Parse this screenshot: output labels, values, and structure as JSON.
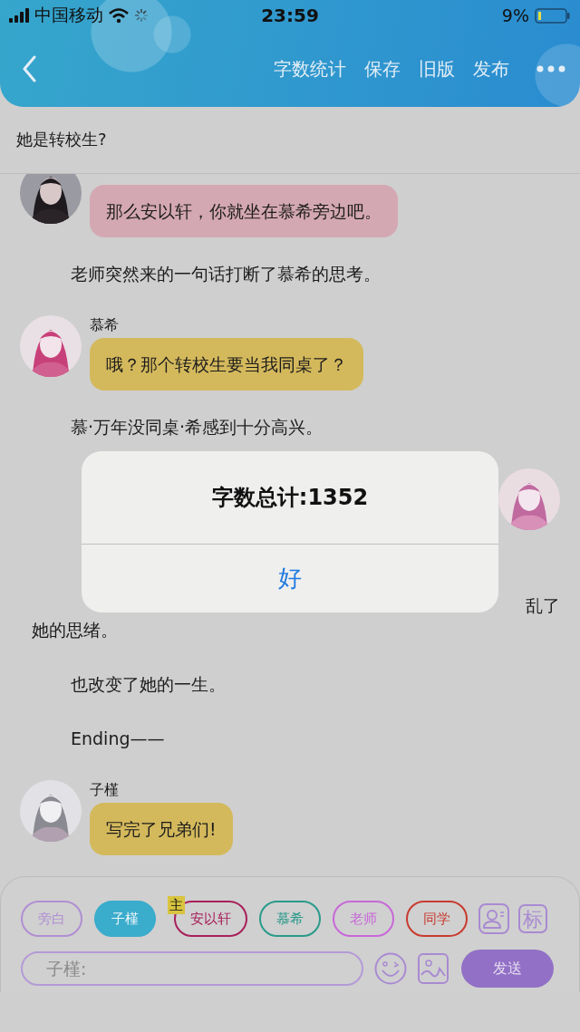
{
  "status_bar": {
    "carrier": "中国移动",
    "time": "23:59",
    "battery": "9%"
  },
  "nav": {
    "actions": [
      "字数统计",
      "保存",
      "旧版",
      "发布"
    ]
  },
  "chapter_title": "她是转校生?",
  "messages": [
    {
      "kind": "bubble",
      "color": "#d4a8b2",
      "text": "那么安以轩，你就坐在慕希旁边吧。"
    },
    {
      "kind": "narration",
      "text": "老师突然来的一句话打断了慕希的思考。"
    },
    {
      "kind": "bubble",
      "name": "慕希",
      "color": "#d4b95c",
      "text": "哦？那个转校生要当我同桌了？"
    },
    {
      "kind": "narration",
      "text": "慕·万年没同桌·希感到十分高兴。"
    },
    {
      "kind": "covered"
    },
    {
      "kind": "split",
      "end": "乱了",
      "rest": "她的思绪。"
    },
    {
      "kind": "narration",
      "text": "也改变了她的一生。"
    },
    {
      "kind": "narration",
      "text": "Ending——"
    },
    {
      "kind": "bubble",
      "name": "子槿",
      "color": "#d4b95c",
      "text": "写完了兄弟们!"
    }
  ],
  "dialog": {
    "title": "字数总计:1352",
    "button": "好"
  },
  "roles": [
    {
      "label": "旁白",
      "color": "#b08fd2",
      "selected": false
    },
    {
      "label": "子槿",
      "color": "#3aaccc",
      "selected": true
    },
    {
      "label": "安以轩",
      "color": "#a8205a",
      "selected": false,
      "badge": "主"
    },
    {
      "label": "慕希",
      "color": "#2a9a8a",
      "selected": false
    },
    {
      "label": "老师",
      "color": "#c868d8",
      "selected": false
    },
    {
      "label": "同学",
      "color": "#c83a30",
      "selected": false
    }
  ],
  "mark_button": "标",
  "composer": {
    "placeholder": "子槿:",
    "send": "发送"
  }
}
